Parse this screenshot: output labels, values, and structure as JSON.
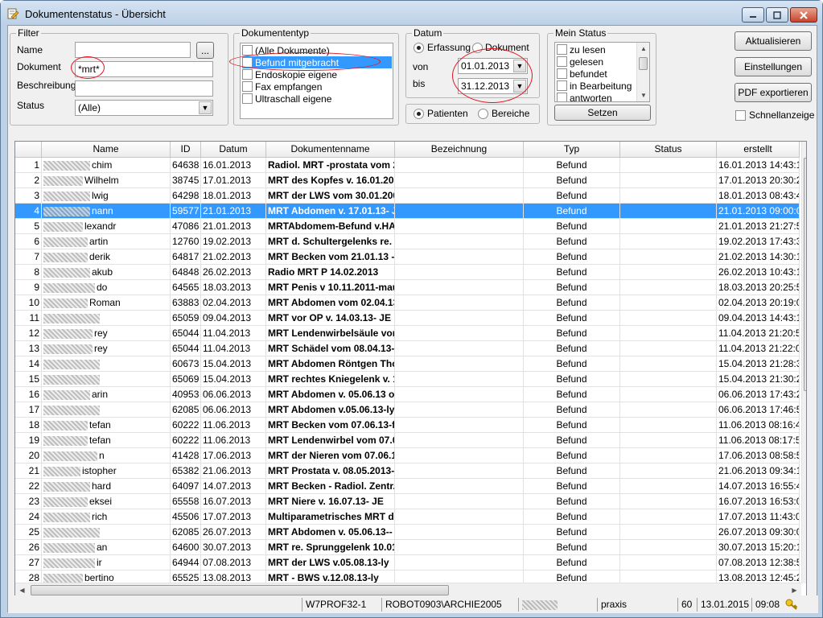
{
  "window": {
    "title": "Dokumentenstatus - Übersicht"
  },
  "filter": {
    "title": "Filter",
    "name_label": "Name",
    "name_value": "",
    "browse_label": "...",
    "dokument_label": "Dokument",
    "dokument_value": "*mrt*",
    "beschreibung_label": "Beschreibung",
    "beschreibung_value": "",
    "status_label": "Status",
    "status_value": "(Alle)"
  },
  "dokumententyp": {
    "title": "Dokumententyp",
    "items": [
      {
        "label": "(Alle Dokumente)",
        "checked": false,
        "selected": false
      },
      {
        "label": "Befund mitgebracht",
        "checked": true,
        "selected": true
      },
      {
        "label": "Endoskopie eigene",
        "checked": false,
        "selected": false
      },
      {
        "label": "Fax empfangen",
        "checked": false,
        "selected": false
      },
      {
        "label": "Ultraschall eigene",
        "checked": false,
        "selected": false
      }
    ]
  },
  "datum": {
    "title": "Datum",
    "erfassung_label": "Erfassung",
    "dokument_label": "Dokument",
    "von_label": "von",
    "von_value": "01.01.2013",
    "bis_label": "bis",
    "bis_value": "31.12.2013",
    "selected_mode": "Erfassung"
  },
  "scope": {
    "patienten_label": "Patienten",
    "bereiche_label": "Bereiche",
    "selected": "Patienten"
  },
  "mein_status": {
    "title": "Mein Status",
    "items": [
      {
        "label": "zu lesen",
        "checked": false
      },
      {
        "label": "gelesen",
        "checked": false
      },
      {
        "label": "befundet",
        "checked": false
      },
      {
        "label": "in Bearbeitung",
        "checked": false
      },
      {
        "label": "antworten",
        "checked": false
      }
    ],
    "setzen_label": "Setzen"
  },
  "actions": {
    "aktualisieren_label": "Aktualisieren",
    "einstellungen_label": "Einstellungen",
    "pdf_label": "PDF exportieren",
    "schnellanzeige_label": "Schnellanzeige",
    "schnellanzeige_checked": false
  },
  "grid": {
    "columns": [
      "",
      "Name",
      "ID",
      "Datum",
      "Dokumentenname",
      "Bezeichnung",
      "Typ",
      "Status",
      "erstellt"
    ],
    "selected_row_index": 3,
    "rows": [
      {
        "n": "1",
        "name": "chim",
        "id": "64638",
        "datum": "16.01.2013",
        "doc": "Radiol. MRT -prostata vom 20.",
        "bez": "",
        "typ": "Befund",
        "status": "",
        "erstellt": "16.01.2013 14:43:18"
      },
      {
        "n": "2",
        "name": "Wilhelm",
        "id": "38745",
        "datum": "17.01.2013",
        "doc": "MRT des Kopfes v. 16.01.2013",
        "bez": "",
        "typ": "Befund",
        "status": "",
        "erstellt": "17.01.2013 20:30:22"
      },
      {
        "n": "3",
        "name": "lwig",
        "id": "64298",
        "datum": "18.01.2013",
        "doc": "MRT der LWS vom 30.01.2006",
        "bez": "",
        "typ": "Befund",
        "status": "",
        "erstellt": "18.01.2013 08:43:44"
      },
      {
        "n": "4",
        "name": "nann",
        "id": "59577",
        "datum": "21.01.2013",
        "doc": "MRT Abdomen v. 17.01.13- JE",
        "bez": "",
        "typ": "Befund",
        "status": "",
        "erstellt": "21.01.2013 09:00:01"
      },
      {
        "n": "5",
        "name": "lexandr",
        "id": "47086",
        "datum": "21.01.2013",
        "doc": "MRTAbdomem-Befund v.HAv.",
        "bez": "",
        "typ": "Befund",
        "status": "",
        "erstellt": "21.01.2013 21:27:54"
      },
      {
        "n": "6",
        "name": "artin",
        "id": "12760",
        "datum": "19.02.2013",
        "doc": "MRT d. Schultergelenks re. v",
        "bez": "",
        "typ": "Befund",
        "status": "",
        "erstellt": "19.02.2013 17:43:39"
      },
      {
        "n": "7",
        "name": "derik",
        "id": "64817",
        "datum": "21.02.2013",
        "doc": "MRT Becken vom 21.01.13 -Fr",
        "bez": "",
        "typ": "Befund",
        "status": "",
        "erstellt": "21.02.2013 14:30:16"
      },
      {
        "n": "8",
        "name": "akub",
        "id": "64848",
        "datum": "26.02.2013",
        "doc": "Radio MRT P 14.02.2013",
        "bez": "",
        "typ": "Befund",
        "status": "",
        "erstellt": "26.02.2013 10:43:17"
      },
      {
        "n": "9",
        "name": "do",
        "id": "64565",
        "datum": "18.03.2013",
        "doc": "MRT Penis v 10.11.2011-mau",
        "bez": "",
        "typ": "Befund",
        "status": "",
        "erstellt": "18.03.2013 20:25:59"
      },
      {
        "n": "10",
        "name": "Roman",
        "id": "63883",
        "datum": "02.04.2013",
        "doc": "MRT Abdomen vom 02.04.13-",
        "bez": "",
        "typ": "Befund",
        "status": "",
        "erstellt": "02.04.2013 20:19:05"
      },
      {
        "n": "11",
        "name": "",
        "id": "65059",
        "datum": "09.04.2013",
        "doc": "MRT vor OP v. 14.03.13- JE",
        "bez": "",
        "typ": "Befund",
        "status": "",
        "erstellt": "09.04.2013 14:43:12"
      },
      {
        "n": "12",
        "name": "rey",
        "id": "65044",
        "datum": "11.04.2013",
        "doc": "MRT Lendenwirbelsäule vom",
        "bez": "",
        "typ": "Befund",
        "status": "",
        "erstellt": "11.04.2013 21:20:59"
      },
      {
        "n": "13",
        "name": "rey",
        "id": "65044",
        "datum": "11.04.2013",
        "doc": "MRT Schädel vom 08.04.13-m",
        "bez": "",
        "typ": "Befund",
        "status": "",
        "erstellt": "11.04.2013 21:22:07"
      },
      {
        "n": "14",
        "name": "",
        "id": "60673",
        "datum": "15.04.2013",
        "doc": "MRT Abdomen Röntgen Thor",
        "bez": "",
        "typ": "Befund",
        "status": "",
        "erstellt": "15.04.2013 21:28:38"
      },
      {
        "n": "15",
        "name": "",
        "id": "65069",
        "datum": "15.04.2013",
        "doc": "MRT rechtes Kniegelenk v. 1:",
        "bez": "",
        "typ": "Befund",
        "status": "",
        "erstellt": "15.04.2013 21:30:29"
      },
      {
        "n": "16",
        "name": "arin",
        "id": "40953",
        "datum": "06.06.2013",
        "doc": "MRT Abdomen v. 05.06.13 o.B",
        "bez": "",
        "typ": "Befund",
        "status": "",
        "erstellt": "06.06.2013 17:43:23"
      },
      {
        "n": "17",
        "name": "",
        "id": "62085",
        "datum": "06.06.2013",
        "doc": "MRT Abdomen v.05.06.13-ly",
        "bez": "",
        "typ": "Befund",
        "status": "",
        "erstellt": "06.06.2013 17:46:56"
      },
      {
        "n": "18",
        "name": "tefan",
        "id": "60222",
        "datum": "11.06.2013",
        "doc": "MRT Becken vom 07.06.13-fr",
        "bez": "",
        "typ": "Befund",
        "status": "",
        "erstellt": "11.06.2013 08:16:47"
      },
      {
        "n": "19",
        "name": "tefan",
        "id": "60222",
        "datum": "11.06.2013",
        "doc": "MRT Lendenwirbel vom 07.0",
        "bez": "",
        "typ": "Befund",
        "status": "",
        "erstellt": "11.06.2013 08:17:59"
      },
      {
        "n": "20",
        "name": "n",
        "id": "41428",
        "datum": "17.06.2013",
        "doc": "MRT der Nieren vom 07.06.13",
        "bez": "",
        "typ": "Befund",
        "status": "",
        "erstellt": "17.06.2013 08:58:56"
      },
      {
        "n": "21",
        "name": "istopher",
        "id": "65382",
        "datum": "21.06.2013",
        "doc": "MRT Prostata v. 08.05.2013-ni",
        "bez": "",
        "typ": "Befund",
        "status": "",
        "erstellt": "21.06.2013 09:34:16"
      },
      {
        "n": "22",
        "name": "hard",
        "id": "64097",
        "datum": "14.07.2013",
        "doc": "MRT Becken - Radiol. Zentr. F",
        "bez": "",
        "typ": "Befund",
        "status": "",
        "erstellt": "14.07.2013 16:55:41"
      },
      {
        "n": "23",
        "name": "eksei",
        "id": "65558",
        "datum": "16.07.2013",
        "doc": "MRT Niere v. 16.07.13- JE",
        "bez": "",
        "typ": "Befund",
        "status": "",
        "erstellt": "16.07.2013 16:53:09"
      },
      {
        "n": "24",
        "name": "rich",
        "id": "45506",
        "datum": "17.07.2013",
        "doc": "Multiparametrisches MRT de",
        "bez": "",
        "typ": "Befund",
        "status": "",
        "erstellt": "17.07.2013 11:43:02"
      },
      {
        "n": "25",
        "name": "",
        "id": "62085",
        "datum": "26.07.2013",
        "doc": "MRT Abdomen v. 05.06.13-- to",
        "bez": "",
        "typ": "Befund",
        "status": "",
        "erstellt": "26.07.2013 09:30:09"
      },
      {
        "n": "26",
        "name": "an",
        "id": "64600",
        "datum": "30.07.2013",
        "doc": "MRT re. Sprunggelenk 10.01.",
        "bez": "",
        "typ": "Befund",
        "status": "",
        "erstellt": "30.07.2013 15:20:16"
      },
      {
        "n": "27",
        "name": "ir",
        "id": "64944",
        "datum": "07.08.2013",
        "doc": "MRT der LWS v.05.08.13-ly",
        "bez": "",
        "typ": "Befund",
        "status": "",
        "erstellt": "07.08.2013 12:38:56"
      },
      {
        "n": "28",
        "name": "bertino",
        "id": "65525",
        "datum": "13.08.2013",
        "doc": "MRT - BWS v.12.08.13-ly",
        "bez": "",
        "typ": "Befund",
        "status": "",
        "erstellt": "13.08.2013 12:45:29"
      }
    ]
  },
  "statusbar": {
    "workstation": "W7PROF32-1",
    "user_path": "ROBOT0903\\ARCHIE2005",
    "mode": "praxis",
    "count": "60",
    "date": "13.01.2015",
    "time": "09:08"
  },
  "colors": {
    "selection": "#3399ff",
    "annotation": "#e0141e",
    "title_bar": "#bcd0e6"
  }
}
